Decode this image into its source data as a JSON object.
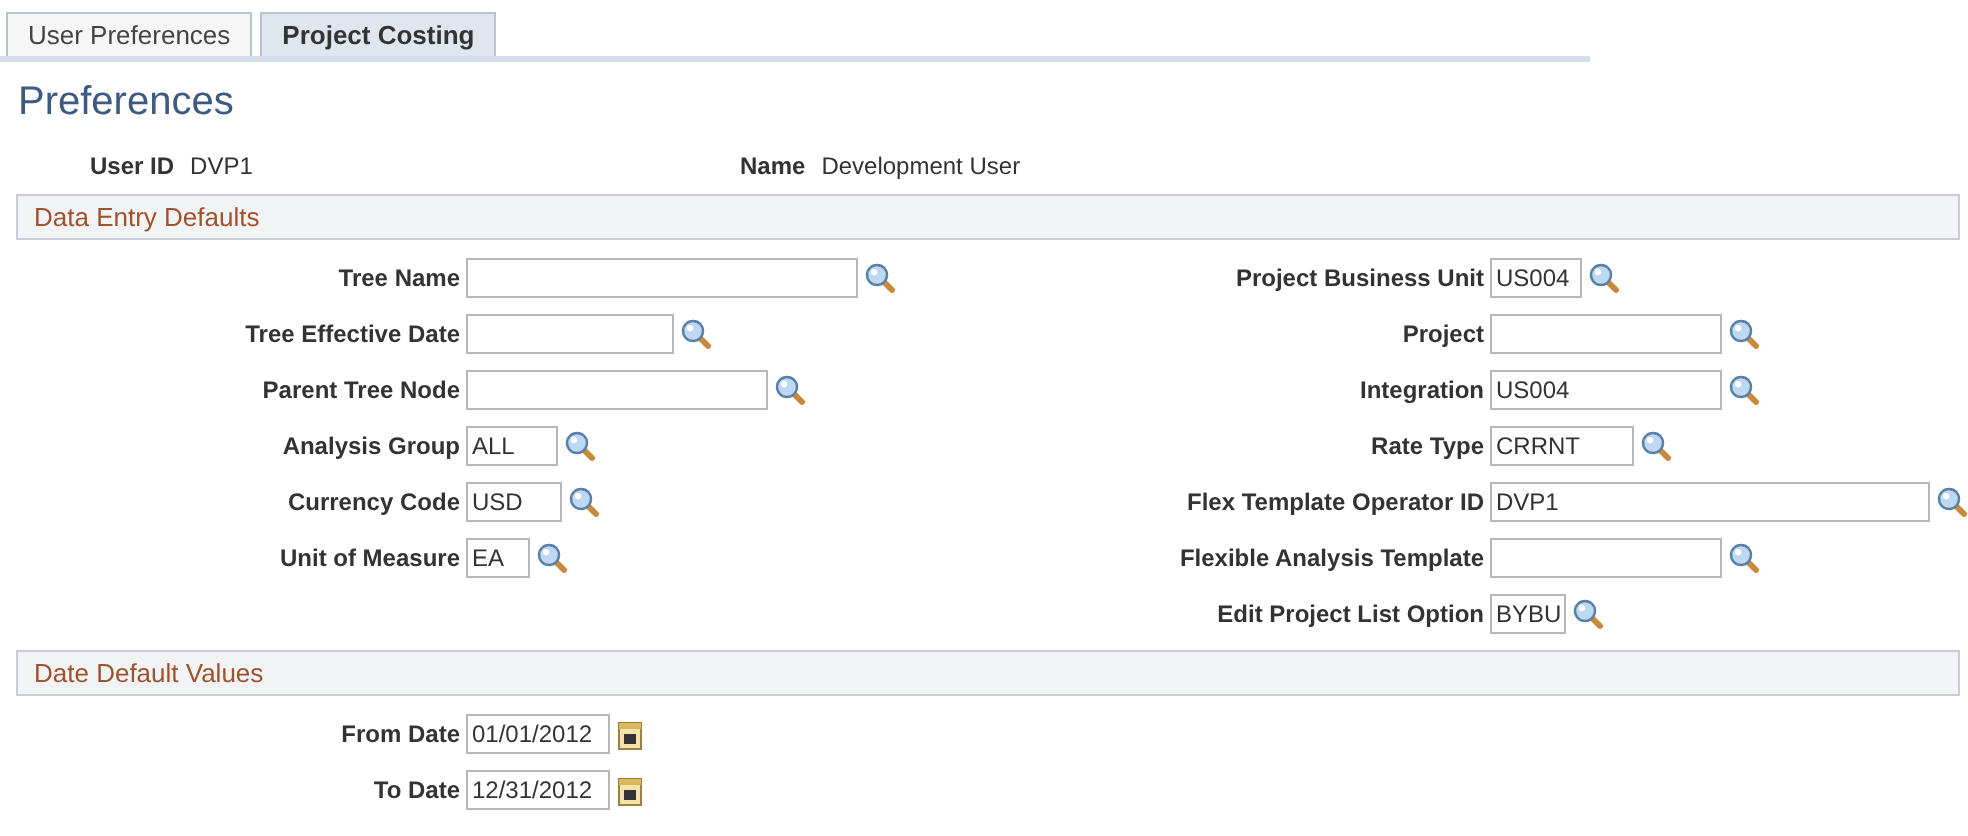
{
  "tabs": [
    {
      "label": "User Preferences",
      "selected": false
    },
    {
      "label": "Project Costing",
      "selected": true
    }
  ],
  "title": "Preferences",
  "header_fields": [
    {
      "label": "User ID",
      "value": "DVP1"
    },
    {
      "label": "Name",
      "value": "Development User"
    }
  ],
  "data_entry_defaults": {
    "title": "Data Entry Defaults",
    "left_fields": [
      {
        "label": "Tree Name"
      },
      {
        "label": "Tree Effective Date"
      },
      {
        "label": "Parent Tree Node"
      },
      {
        "label": "Analysis Group",
        "value": "ALL"
      },
      {
        "label": "Currency Code",
        "value": "USD"
      },
      {
        "label": "Unit of Measure",
        "value": "EA"
      }
    ],
    "right_fields": [
      {
        "label": "Project Business Unit",
        "value": "US004"
      },
      {
        "label": "Project"
      },
      {
        "label": "Integration",
        "value": "US004"
      },
      {
        "label": "Rate Type",
        "value": "CRRNT"
      },
      {
        "label": "Flex Template Operator ID",
        "value": "DVP1"
      },
      {
        "label": "Flexible Analysis Template"
      },
      {
        "label": "Edit Project List Option",
        "value": "BYBU"
      }
    ]
  },
  "date_default_values": {
    "title": "Date Default Values",
    "fields": [
      {
        "label": "From Date",
        "value": "01/01/2012"
      },
      {
        "label": "To Date",
        "value": "12/31/2012"
      }
    ]
  }
}
